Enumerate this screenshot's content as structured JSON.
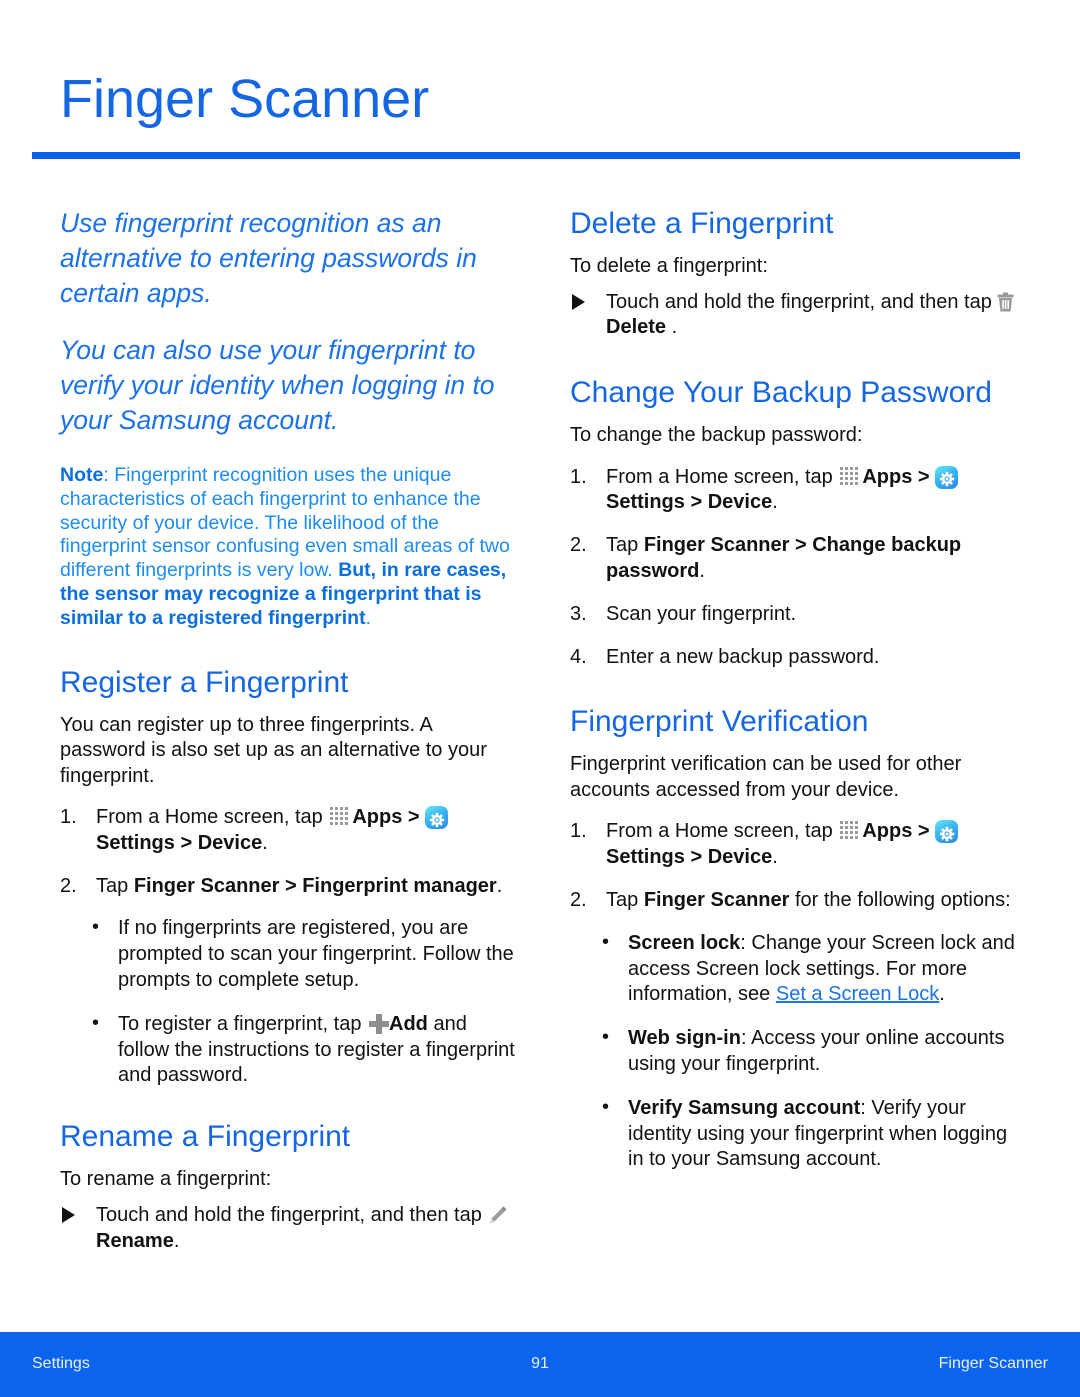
{
  "document": {
    "title": "Finger Scanner",
    "intro_paragraphs": [
      "Use fingerprint recognition as an alternative to entering passwords in certain apps.",
      "You can also use your fingerprint to verify your identity when logging in to your Samsung account."
    ],
    "note": {
      "lead": "Note",
      "separator": ": ",
      "regular_text": "Fingerprint recognition uses the unique characteristics of each fingerprint to enhance the security of your device. The likelihood of the fingerprint sensor confusing even small areas of two different fingerprints is very low. ",
      "bold_text": "But, in rare cases, the sensor may recognize a fingerprint that is similar to a registered fingerprint",
      "end_period": "."
    }
  },
  "icons": {
    "apps": "apps-grid-icon",
    "settings": "settings-gear-icon",
    "add": "add-plus-icon",
    "delete": "trash-icon",
    "rename": "pencil-icon"
  },
  "left_column": {
    "register": {
      "heading": "Register a Fingerprint",
      "body": "You can register up to three fingerprints. A password is also set up as an alternative to your fingerprint.",
      "steps": [
        {
          "number": "1.",
          "prefix": "From a Home screen, tap ",
          "apps_label": "Apps",
          "sep1": " > ",
          "settings_label": "Settings",
          "sep2": " > ",
          "device_label": "Device",
          "suffix": "."
        },
        {
          "number": "2.",
          "prefix": "Tap ",
          "bold1": "Finger Scanner",
          "sep1": " > ",
          "bold2": "Fingerprint manager",
          "suffix": "."
        }
      ],
      "bullets": [
        {
          "text": "If no fingerprints are registered, you are prompted to scan your fingerprint. Follow the prompts to complete setup."
        },
        {
          "prefix": "To register a fingerprint, tap ",
          "icon_label": "Add",
          "suffix": " and follow the instructions to register a fingerprint and password."
        }
      ]
    },
    "rename": {
      "heading": "Rename a Fingerprint",
      "body": "To rename a fingerprint:",
      "action": {
        "prefix": "Touch and hold the fingerprint, and then tap ",
        "icon_label": "Rename",
        "suffix": "."
      }
    }
  },
  "right_column": {
    "delete": {
      "heading": "Delete a Fingerprint",
      "body": "To delete a fingerprint:",
      "action": {
        "prefix": "Touch and hold the fingerprint, and then tap ",
        "icon_label": "Delete",
        "suffix": " ."
      }
    },
    "backup_password": {
      "heading": "Change Your Backup Password",
      "body": "To change the backup password:",
      "steps": [
        {
          "number": "1.",
          "prefix": "From a Home screen, tap ",
          "apps_label": "Apps",
          "sep1": " > ",
          "settings_label": "Settings",
          "sep2": " > ",
          "device_label": "Device",
          "suffix": "."
        },
        {
          "number": "2.",
          "prefix": "Tap ",
          "bold1": "Finger Scanner",
          "sep1": " > ",
          "bold2": "Change backup password",
          "suffix": "."
        },
        {
          "number": "3.",
          "plain": "Scan your fingerprint."
        },
        {
          "number": "4.",
          "plain": "Enter a new backup password."
        }
      ]
    },
    "verification": {
      "heading": "Fingerprint Verification",
      "body": "Fingerprint verification can be used for other accounts accessed from your device.",
      "steps": [
        {
          "number": "1.",
          "prefix": "From a Home screen, tap ",
          "apps_label": "Apps",
          "sep1": " > ",
          "settings_label": "Settings",
          "sep2": " > ",
          "device_label": "Device",
          "suffix": "."
        },
        {
          "number": "2.",
          "prefix": "Tap ",
          "bold1": "Finger Scanner",
          "suffix": " for the following options:"
        }
      ],
      "options": [
        {
          "term": "Screen lock",
          "text_before_link": ": Change your Screen lock and access Screen lock settings. For more information, see ",
          "link": "Set a Screen Lock",
          "text_after_link": "."
        },
        {
          "term": "Web sign-in",
          "text": ": Access your online accounts using your fingerprint."
        },
        {
          "term": "Verify Samsung account",
          "text": ": Verify your identity using your fingerprint when logging in to your Samsung account."
        }
      ]
    }
  },
  "footer": {
    "left": "Settings",
    "page_number": "91",
    "right": "Finger Scanner"
  },
  "colors": {
    "heading_blue": "#1566E3",
    "rule_blue": "#0B5FE8",
    "note_blue": "#1C8CF0",
    "link_blue": "#1C72EA",
    "footer_blue": "#0B63EE",
    "body_black": "#121212"
  }
}
